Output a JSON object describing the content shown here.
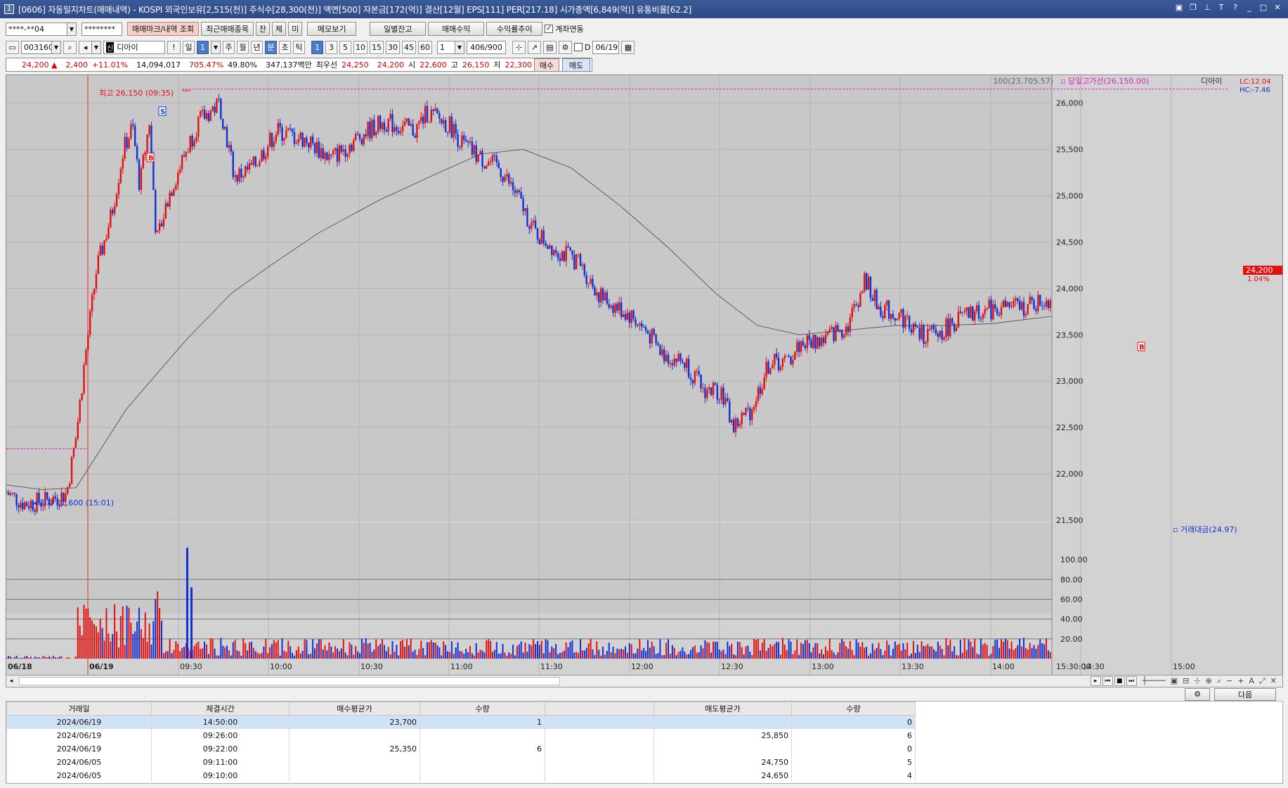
{
  "window": {
    "title": "[0606] 자동일지차트(매매내역) - KOSPI 외국인보유[2,515(천)] 주식수[28,300(천)] 액면[500] 자본금[172(억)] 결산[12월] EPS[111] PER[217.18] 시가총액[6,849(억)] 유통비율[62.2]",
    "icon_label": "1"
  },
  "toolbar1": {
    "account": "****-**04",
    "password": "********",
    "btn_trade_mark": "매매마크/내역 조회",
    "btn_recent": "최근매매종목",
    "tab_jan": "잔",
    "tab_che": "체",
    "tab_mi": "미",
    "btn_memo": "메모보기",
    "btn_daily_balance": "일별잔고",
    "btn_trade_profit": "매매수익",
    "btn_profit_trend": "수익률추이",
    "chk_account_link": "계좌연동"
  },
  "toolbar2": {
    "code": "003160",
    "name_badge": "신",
    "name": "디아이",
    "excl": "!",
    "periods": [
      "일",
      "1",
      "주",
      "월",
      "년",
      "분",
      "초",
      "틱"
    ],
    "minutes": [
      "1",
      "3",
      "5",
      "10",
      "15",
      "30",
      "45",
      "60"
    ],
    "count": "1",
    "range": "406/900",
    "d_label": "D",
    "date": "06/19"
  },
  "quote": {
    "price": "24,200 ▲",
    "change": "2,400",
    "pct": "+11.01%",
    "volume": "14,094,017",
    "vol_ratio": "705.47%",
    "turnover": "49.80%",
    "amount": "347,137백만",
    "best_label": "최우선",
    "best_sell": "24,250",
    "best_buy": "24,200",
    "open_label": "시",
    "open": "22,600",
    "high_label": "고",
    "high": "26,150",
    "low_label": "저",
    "low": "22,300",
    "buy_btn": "매수",
    "sell_btn": "매도"
  },
  "chart_labels": {
    "high_marker": "최고 26,150 (09:35)",
    "low_marker": "최저 21,600 (15:01)",
    "ma_legend": "100(23,705.57)",
    "day_high_legend": "당일고가선(26,150.00)",
    "name_legend": "디아이",
    "lc": "LC:12.04",
    "hc": "HC:-7.46",
    "last_price": "24,200",
    "last_pct": "1.04%",
    "vol_legend": "거래대금(24.97)",
    "mark_s": "S",
    "mark_b": "B"
  },
  "chart_data": {
    "type": "candlestick",
    "price_axis": [
      "26,000",
      "25,500",
      "25,000",
      "24,500",
      "24,000",
      "23,500",
      "23,000",
      "22,500",
      "22,000",
      "21,500"
    ],
    "price_range": [
      21500,
      26300
    ],
    "volume_axis": [
      "100.00",
      "80.00",
      "60.00",
      "40.00",
      "20.00"
    ],
    "time_axis": [
      "06/18",
      "06/19",
      "09:30",
      "10:00",
      "10:30",
      "11:00",
      "11:30",
      "12:00",
      "12:30",
      "13:00",
      "13:30",
      "14:00",
      "14:30",
      "15:00",
      "15:30:00"
    ],
    "prev_close": 21800,
    "day_high": 26150,
    "day_low": 21600,
    "last": 24200
  },
  "scroll_tools": [
    "▸",
    "⏮",
    "■",
    "⏭"
  ],
  "bottom": {
    "next_btn": "다음",
    "headers": [
      "거래일",
      "체결시간",
      "매수평균가",
      "수량",
      "",
      "매도평균가",
      "수량"
    ],
    "rows": [
      [
        "2024/06/19",
        "14:50:00",
        "23,700",
        "1",
        "",
        "",
        "0"
      ],
      [
        "2024/06/19",
        "09:26:00",
        "",
        "",
        "",
        "25,850",
        "6"
      ],
      [
        "2024/06/19",
        "09:22:00",
        "25,350",
        "6",
        "",
        "",
        "0"
      ],
      [
        "2024/06/05",
        "09:11:00",
        "",
        "",
        "",
        "24,750",
        "5"
      ],
      [
        "2024/06/05",
        "09:10:00",
        "",
        "",
        "",
        "24,650",
        "4"
      ]
    ]
  }
}
